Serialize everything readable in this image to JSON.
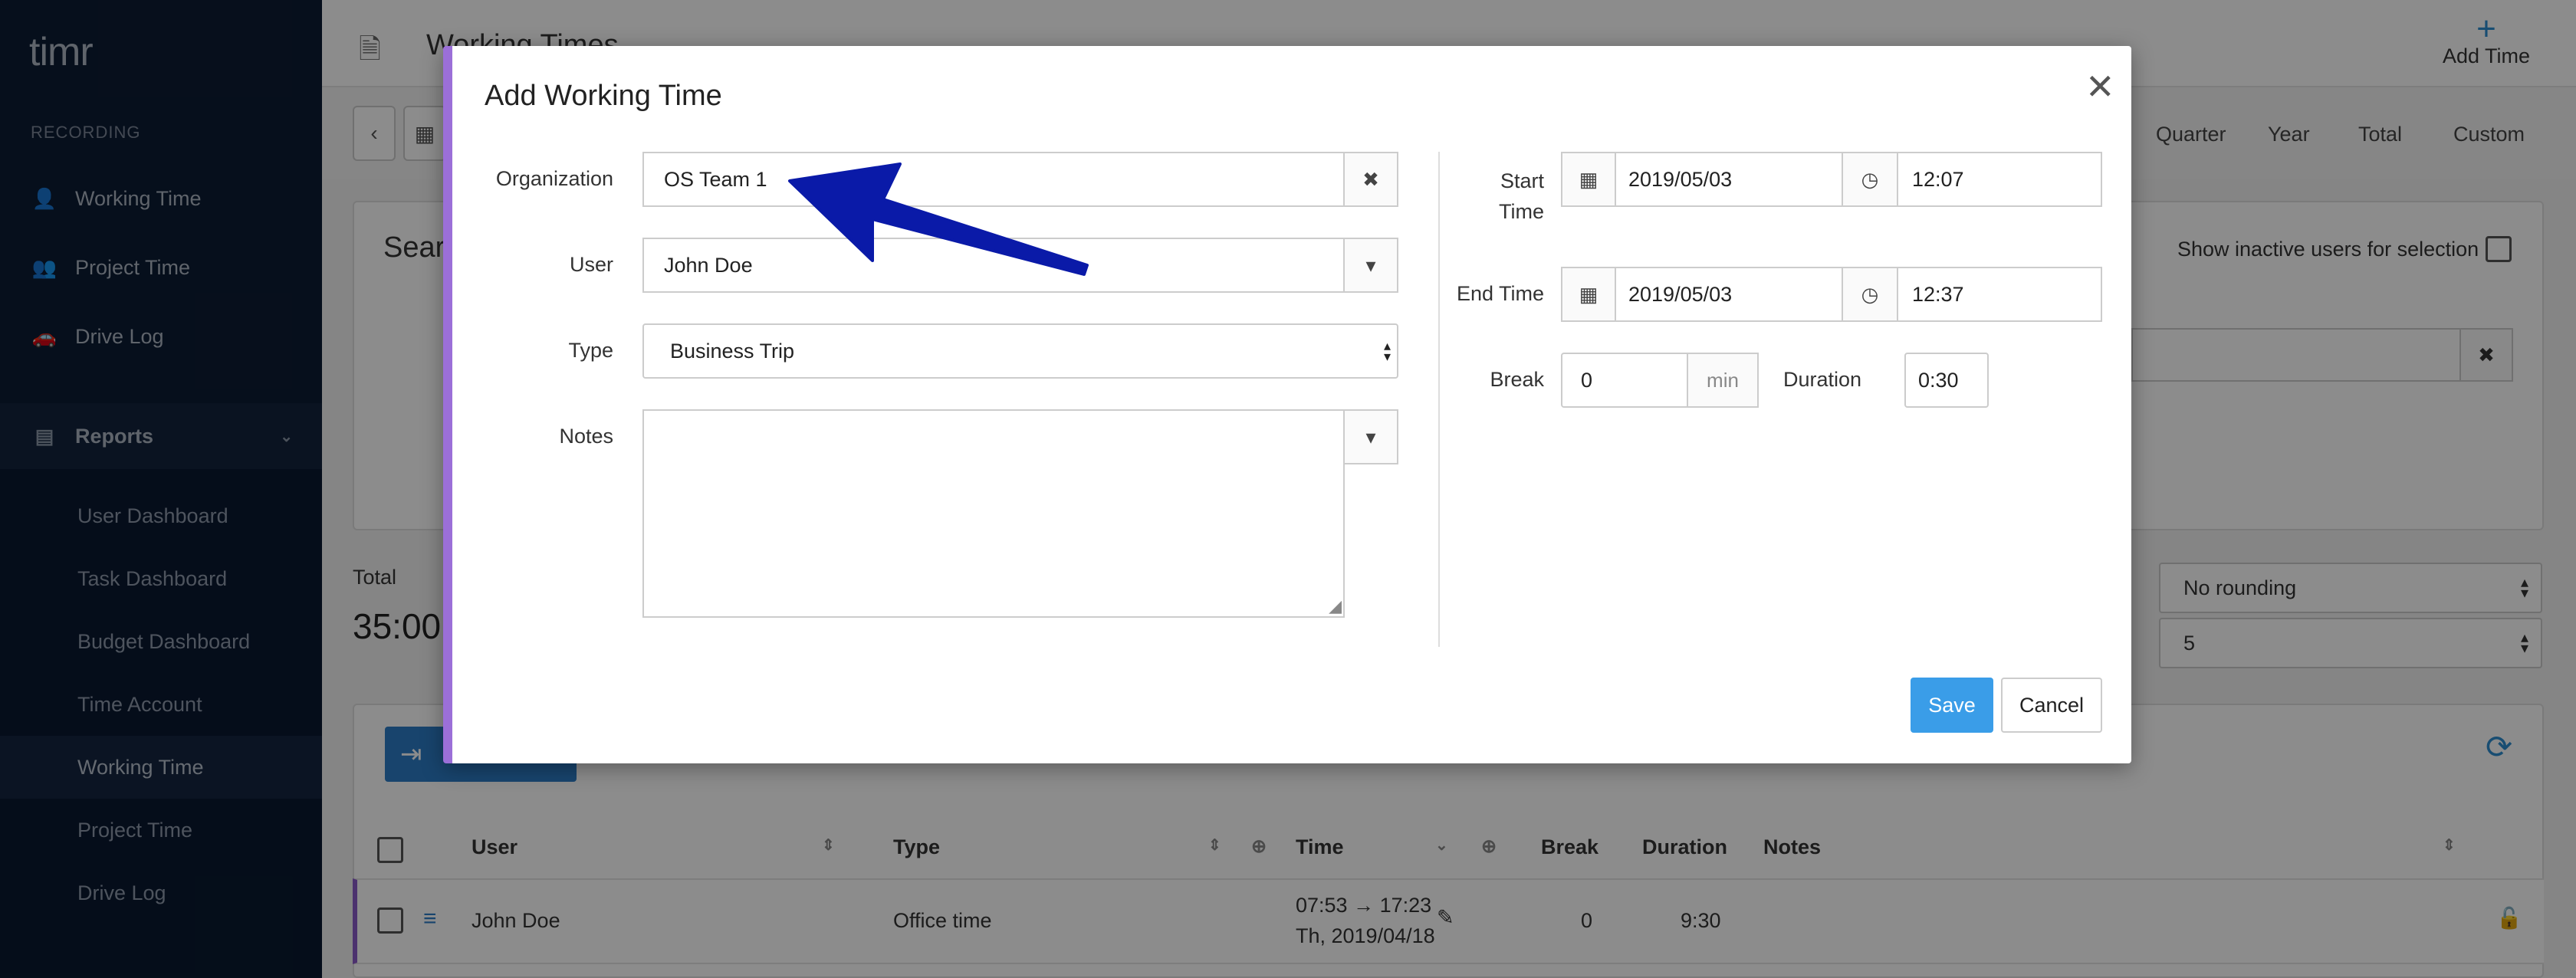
{
  "sidebar": {
    "logo": "timr",
    "section_label": "RECORDING",
    "recording_items": [
      {
        "label": "Working Time",
        "icon": "user-clock-icon"
      },
      {
        "label": "Project Time",
        "icon": "users-clock-icon"
      },
      {
        "label": "Drive Log",
        "icon": "car-icon"
      }
    ],
    "reports_label": "Reports",
    "report_items": [
      {
        "label": "User Dashboard"
      },
      {
        "label": "Task Dashboard"
      },
      {
        "label": "Budget Dashboard"
      },
      {
        "label": "Time Account"
      },
      {
        "label": "Working Time"
      },
      {
        "label": "Project Time"
      },
      {
        "label": "Drive Log"
      }
    ]
  },
  "header": {
    "title": "Working Times",
    "add_time_label": "Add Time"
  },
  "toolbar": {
    "periods": [
      "Quarter",
      "Year",
      "Total",
      "Custom"
    ]
  },
  "search": {
    "title": "Search",
    "inactive_label": "Show inactive users for selection"
  },
  "summary": {
    "total_label": "Total",
    "total_value": "35:00",
    "rounding": "No rounding",
    "rounding_step": "5"
  },
  "table": {
    "headers": {
      "user": "User",
      "type": "Type",
      "time": "Time",
      "break": "Break",
      "duration": "Duration",
      "notes": "Notes"
    },
    "rows": [
      {
        "user": "John Doe",
        "type": "Office time",
        "time_range": "07:53 → 17:23",
        "date": "Th, 2019/04/18",
        "break": "0",
        "duration": "9:30"
      }
    ]
  },
  "modal": {
    "title": "Add Working Time",
    "organization_label": "Organization",
    "organization_value": "OS Team 1",
    "user_label": "User",
    "user_value": "John Doe",
    "type_label": "Type",
    "type_value": "Business Trip",
    "notes_label": "Notes",
    "notes_value": "",
    "start_label_1": "Start",
    "start_label_2": "Time",
    "start_date": "2019/05/03",
    "start_time": "12:07",
    "end_label": "End Time",
    "end_date": "2019/05/03",
    "end_time": "12:37",
    "break_label": "Break",
    "break_value": "0",
    "break_unit": "min",
    "duration_label": "Duration",
    "duration_value": "0:30",
    "save_label": "Save",
    "cancel_label": "Cancel"
  },
  "colors": {
    "sidebar_bg": "#0c1c33",
    "accent_blue": "#3a9de8",
    "modal_stripe": "#9b6fd8",
    "annotation_arrow": "#0a1aa8"
  }
}
